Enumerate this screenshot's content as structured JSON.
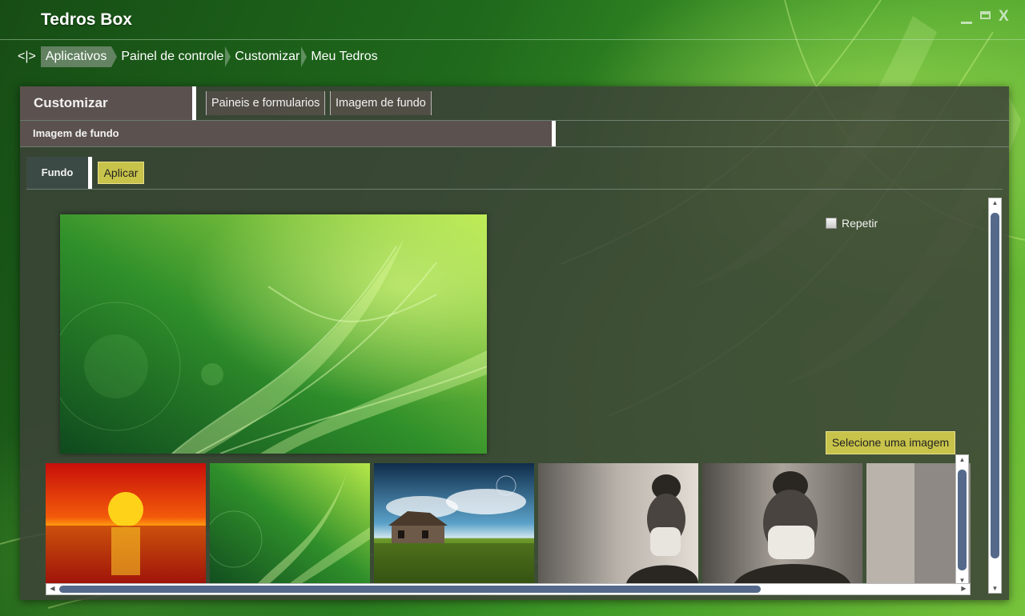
{
  "window": {
    "title": "Tedros Box",
    "controls": {
      "minimize_icon": "minimize-icon",
      "maximize_icon": "maximize-icon",
      "close_label": "X"
    }
  },
  "breadcrumb": {
    "nav_label": "<|>",
    "items": [
      "Aplicativos",
      "Painel de controle",
      "Customizar",
      "Meu Tedros"
    ],
    "active_index": 0
  },
  "panel": {
    "title": "Customizar",
    "tabs": [
      "Paineis e formularios",
      "Imagem de fundo"
    ],
    "subtitle": "Imagem de fundo",
    "inner_tab": "Fundo",
    "apply_label": "Aplicar",
    "repeat_label": "Repetir",
    "repeat_checked": false,
    "select_image_label": "Selecione uma imagem"
  },
  "thumbnails": [
    {
      "name": "thumb-sunset",
      "subject": "sunset over sea"
    },
    {
      "name": "thumb-green-swirl",
      "subject": "green abstract swirl"
    },
    {
      "name": "thumb-house-field",
      "subject": "old house in grass field"
    },
    {
      "name": "thumb-girl-mask-1",
      "subject": "girl wearing mask, black and white"
    },
    {
      "name": "thumb-girl-mask-2",
      "subject": "girl wearing mask, black and white close-up"
    },
    {
      "name": "thumb-partial",
      "subject": "partially visible photo"
    }
  ],
  "colors": {
    "accent_yellow": "#c8c34a",
    "panel_header": "#5b524f",
    "scrollbar_thumb": "#556a8a"
  }
}
